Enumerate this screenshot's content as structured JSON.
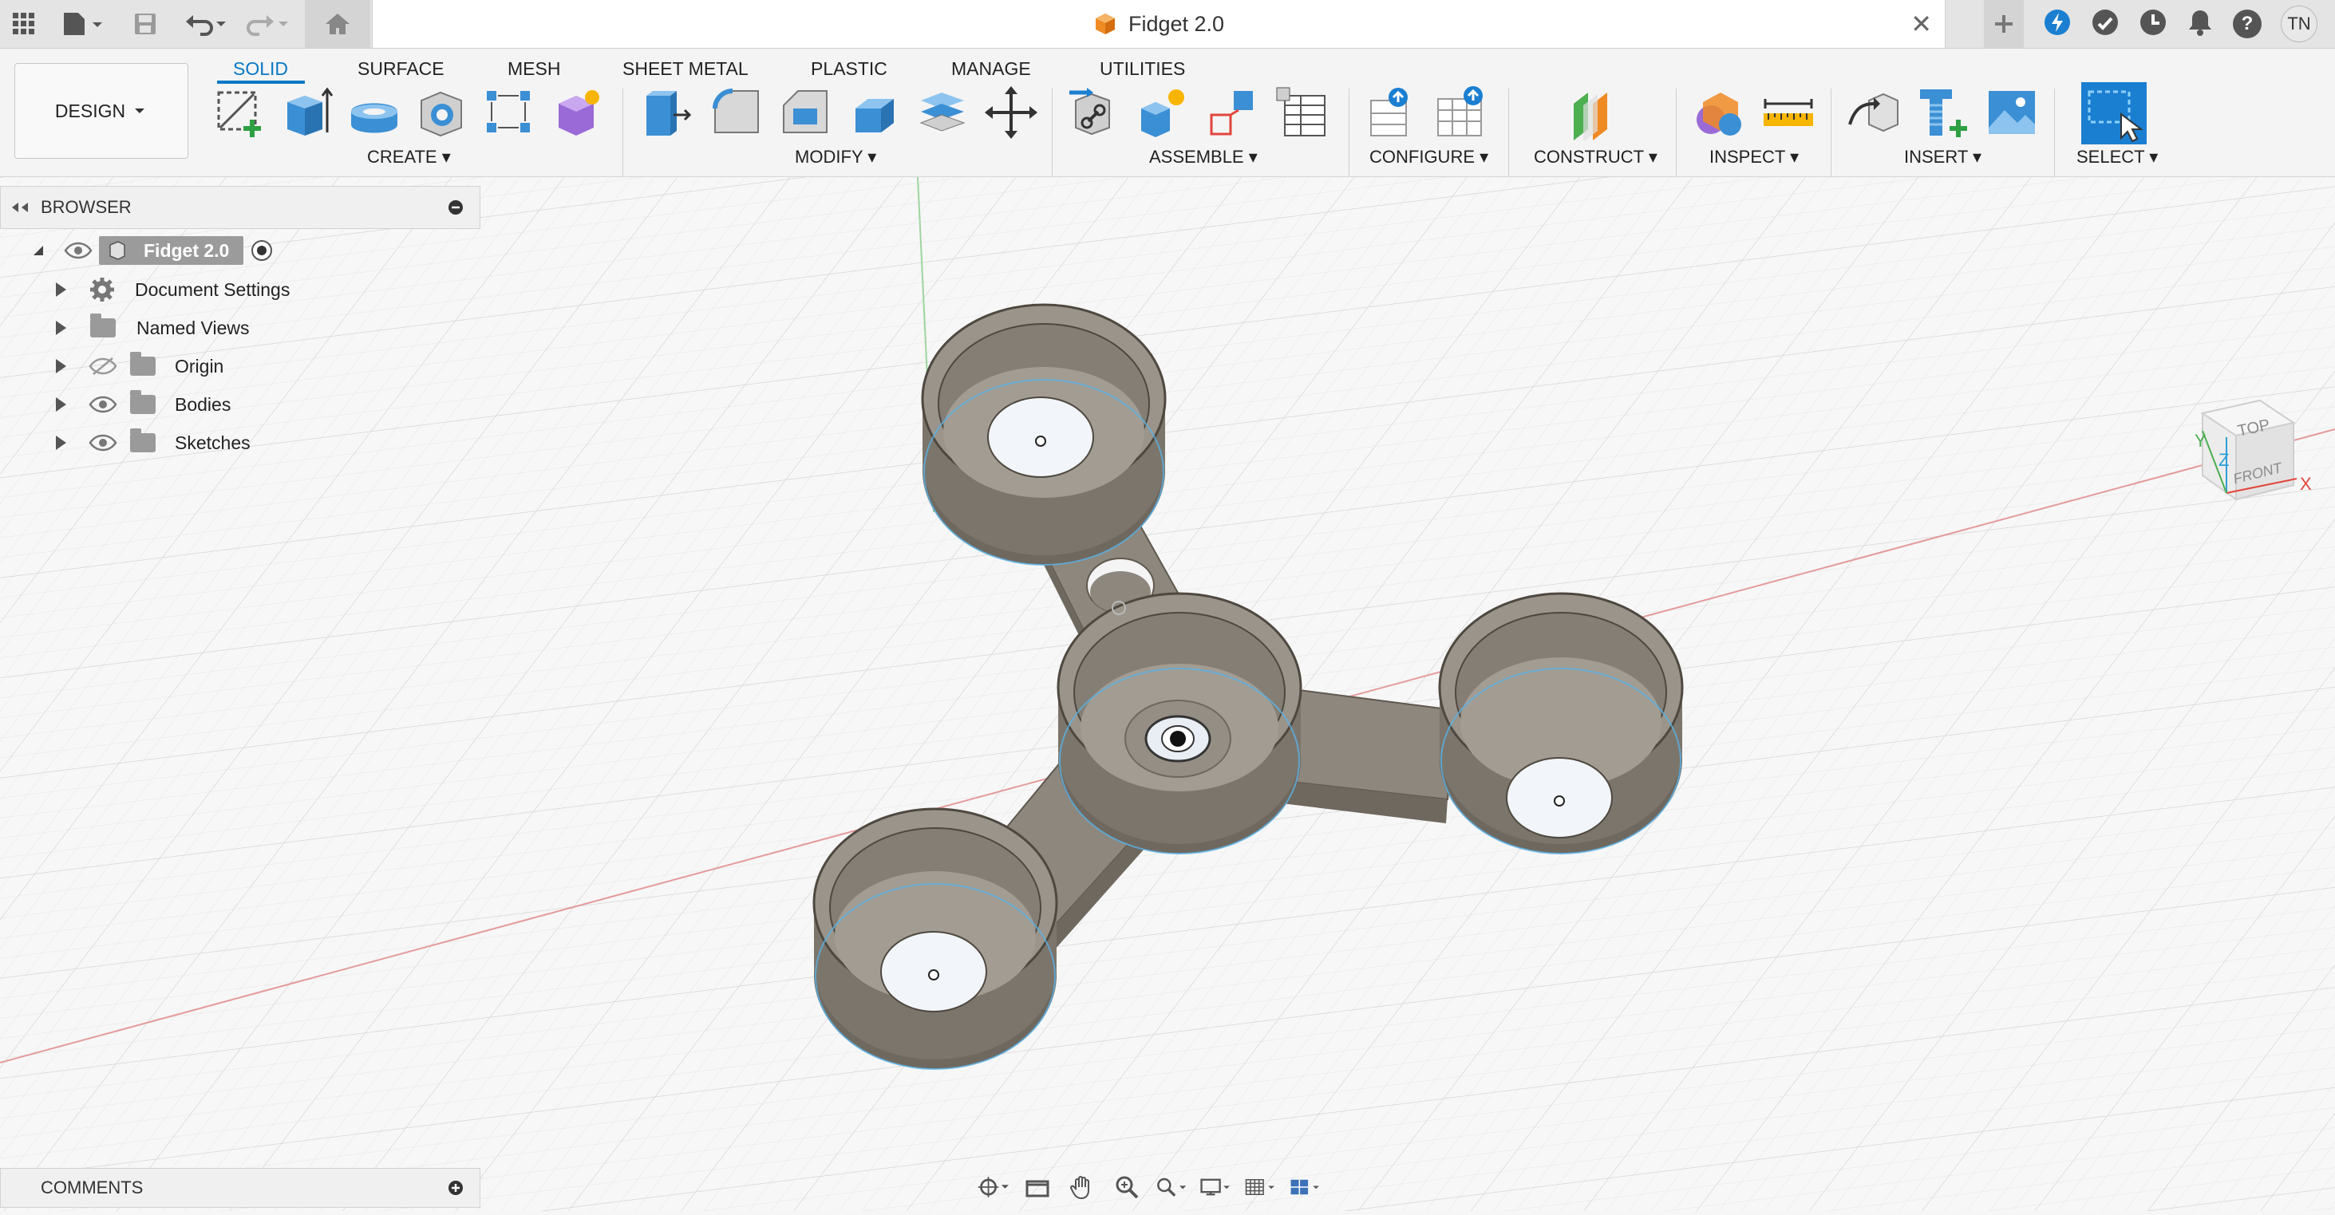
{
  "titlebar": {
    "document_title": "Fidget 2.0",
    "close_glyph": "✕",
    "avatar_initials": "TN",
    "help_glyph": "?"
  },
  "toolbar": {
    "workspace_button": "DESIGN",
    "tabs": [
      "SOLID",
      "SURFACE",
      "MESH",
      "SHEET METAL",
      "PLASTIC",
      "MANAGE",
      "UTILITIES"
    ],
    "active_tab": "SOLID",
    "groups": [
      "CREATE",
      "MODIFY",
      "ASSEMBLE",
      "CONFIGURE",
      "CONSTRUCT",
      "INSPECT",
      "INSERT",
      "SELECT"
    ]
  },
  "browser": {
    "title": "BROWSER",
    "root": "Fidget 2.0",
    "items": [
      "Document Settings",
      "Named Views",
      "Origin",
      "Bodies",
      "Sketches"
    ]
  },
  "viewcube": {
    "top": "TOP",
    "front": "FRONT",
    "axis_x": "X",
    "axis_y": "Y",
    "axis_z": "Z"
  },
  "comments": {
    "title": "COMMENTS"
  },
  "colors": {
    "accent": "#0a78c5",
    "body": "#8e877d",
    "body_dark": "#6f685f",
    "body_light": "#a39c92",
    "edge_blue": "#5ab2e6"
  }
}
